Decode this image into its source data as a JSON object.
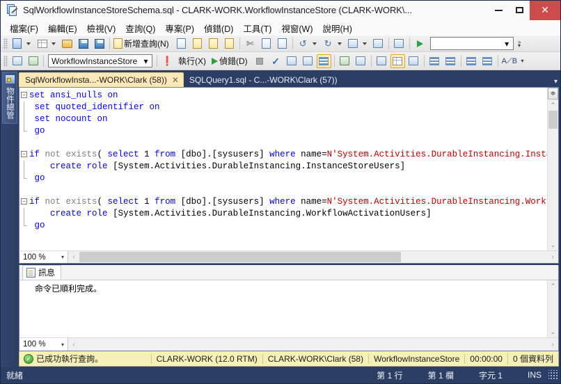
{
  "window": {
    "title": "SqlWorkflowInstanceStoreSchema.sql - CLARK-WORK.WorkflowInstanceStore (CLARK-WORK\\...",
    "minimize_label": "",
    "maximize_label": "",
    "close_label": "✕"
  },
  "menu": {
    "items": [
      {
        "label": "檔案(F)"
      },
      {
        "label": "編輯(E)"
      },
      {
        "label": "檢視(V)"
      },
      {
        "label": "查詢(Q)"
      },
      {
        "label": "專案(P)"
      },
      {
        "label": "偵錯(D)"
      },
      {
        "label": "工具(T)"
      },
      {
        "label": "視窗(W)"
      },
      {
        "label": "說明(H)"
      }
    ]
  },
  "toolbar_standard": {
    "new_query_label": "新增查詢(N)",
    "buttons": [
      {
        "name": "new-project-icon"
      },
      {
        "name": "new-item-icon"
      },
      {
        "name": "open-file-icon"
      },
      {
        "name": "save-icon"
      },
      {
        "name": "save-all-icon"
      },
      {
        "name": "new-query-icon"
      },
      {
        "name": "new-db-engine-query-icon"
      },
      {
        "name": "new-mdx-query-icon"
      },
      {
        "name": "new-dmx-query-icon"
      },
      {
        "name": "new-xmla-query-icon"
      },
      {
        "name": "cut-icon"
      },
      {
        "name": "copy-icon"
      },
      {
        "name": "paste-icon"
      },
      {
        "name": "undo-icon"
      },
      {
        "name": "redo-icon"
      },
      {
        "name": "navigate-icon"
      },
      {
        "name": "solution-icon"
      },
      {
        "name": "activity-monitor-icon"
      },
      {
        "name": "start-debug-icon"
      }
    ],
    "config_combo_value": ""
  },
  "toolbar_editor": {
    "database_value": "WorkflowInstanceStore",
    "execute_label": "執行(X)",
    "debug_label": "偵錯(D)",
    "buttons": [
      {
        "name": "connect-icon"
      },
      {
        "name": "disconnect-icon"
      },
      {
        "name": "execute-warning-icon"
      },
      {
        "name": "stop-icon"
      },
      {
        "name": "parse-icon"
      },
      {
        "name": "display-estimated-plan-icon"
      },
      {
        "name": "query-options-icon"
      },
      {
        "name": "include-actual-plan-icon",
        "active": true
      },
      {
        "name": "include-client-statistics-icon"
      },
      {
        "name": "sqlcmd-mode-icon"
      },
      {
        "name": "results-to-text-icon"
      },
      {
        "name": "results-to-grid-icon",
        "active": true
      },
      {
        "name": "results-to-file-icon"
      },
      {
        "name": "comment-icon"
      },
      {
        "name": "uncomment-icon"
      },
      {
        "name": "decrease-indent-icon"
      },
      {
        "name": "increase-indent-icon"
      },
      {
        "name": "specify-values-icon"
      }
    ]
  },
  "object_explorer": {
    "label": "物件總管"
  },
  "tabs": [
    {
      "label": "SqlWorkflowInsta...-WORK\\Clark (58))",
      "active": true,
      "close": "✕"
    },
    {
      "label": "SQLQuery1.sql - C...-WORK\\Clark (57))",
      "active": false
    }
  ],
  "editor": {
    "zoom": "100 %",
    "zoom_caret": "▾",
    "code_lines": [
      {
        "fold": "minus",
        "segments": [
          {
            "text": "set",
            "cls": "kw"
          },
          {
            "text": " ansi_nulls ",
            "cls": "kw"
          },
          {
            "text": "on",
            "cls": "kw"
          }
        ]
      },
      {
        "fold": "bar",
        "segments": [
          {
            "text": " set",
            "cls": "kw"
          },
          {
            "text": " quoted_identifier ",
            "cls": "kw"
          },
          {
            "text": "on",
            "cls": "kw"
          }
        ]
      },
      {
        "fold": "bar",
        "segments": [
          {
            "text": " set",
            "cls": "kw"
          },
          {
            "text": " nocount ",
            "cls": "kw"
          },
          {
            "text": "on",
            "cls": "kw"
          }
        ]
      },
      {
        "fold": "end",
        "segments": [
          {
            "text": " go",
            "cls": "kw"
          }
        ]
      },
      {
        "fold": "none",
        "segments": [
          {
            "text": "",
            "cls": "blk"
          }
        ]
      },
      {
        "fold": "minus",
        "segments": [
          {
            "text": "if",
            "cls": "kw"
          },
          {
            "text": " not exists",
            "cls": "gray"
          },
          {
            "text": "( ",
            "cls": "blk"
          },
          {
            "text": "select",
            "cls": "kw"
          },
          {
            "text": " 1 ",
            "cls": "blk"
          },
          {
            "text": "from",
            "cls": "kw"
          },
          {
            "text": " [dbo].[sysusers] ",
            "cls": "blk"
          },
          {
            "text": "where",
            "cls": "kw"
          },
          {
            "text": " name=",
            "cls": "blk"
          },
          {
            "text": "N'System.Activities.DurableInstancing.Instan",
            "cls": "str"
          }
        ]
      },
      {
        "fold": "bar",
        "segments": [
          {
            "text": "    ",
            "cls": "blk"
          },
          {
            "text": "create",
            "cls": "kw"
          },
          {
            "text": " ",
            "cls": "blk"
          },
          {
            "text": "role",
            "cls": "kw"
          },
          {
            "text": " [System.Activities.DurableInstancing.InstanceStoreUsers]",
            "cls": "blk"
          }
        ]
      },
      {
        "fold": "end",
        "segments": [
          {
            "text": " go",
            "cls": "kw"
          }
        ]
      },
      {
        "fold": "none",
        "segments": [
          {
            "text": "",
            "cls": "blk"
          }
        ]
      },
      {
        "fold": "minus",
        "segments": [
          {
            "text": "if",
            "cls": "kw"
          },
          {
            "text": " not exists",
            "cls": "gray"
          },
          {
            "text": "( ",
            "cls": "blk"
          },
          {
            "text": "select",
            "cls": "kw"
          },
          {
            "text": " 1 ",
            "cls": "blk"
          },
          {
            "text": "from",
            "cls": "kw"
          },
          {
            "text": " [dbo].[sysusers] ",
            "cls": "blk"
          },
          {
            "text": "where",
            "cls": "kw"
          },
          {
            "text": " name=",
            "cls": "blk"
          },
          {
            "text": "N'System.Activities.DurableInstancing.Workf",
            "cls": "str"
          }
        ]
      },
      {
        "fold": "bar",
        "segments": [
          {
            "text": "    ",
            "cls": "blk"
          },
          {
            "text": "create",
            "cls": "kw"
          },
          {
            "text": " ",
            "cls": "blk"
          },
          {
            "text": "role",
            "cls": "kw"
          },
          {
            "text": " [System.Activities.DurableInstancing.WorkflowActivationUsers]",
            "cls": "blk"
          }
        ]
      },
      {
        "fold": "end",
        "segments": [
          {
            "text": " go",
            "cls": "kw"
          }
        ]
      }
    ]
  },
  "results": {
    "tab_label": "訊息",
    "message": "命令已順利完成。",
    "zoom": "100 %",
    "zoom_caret": "▾"
  },
  "query_status": {
    "status_text": "已成功執行查詢。",
    "server": "CLARK-WORK (12.0 RTM)",
    "user": "CLARK-WORK\\Clark (58)",
    "database": "WorkflowInstanceStore",
    "elapsed": "00:00:00",
    "rows": "0 個資料列"
  },
  "statusbar": {
    "ready": "就緒",
    "line": "第 1 行",
    "column": "第 1 欄",
    "character": "字元 1",
    "insert_mode": "INS"
  },
  "colors": {
    "chrome": "#2c3e63",
    "accent_tab": "#fde9b8",
    "status_bar": "#f4f0b8",
    "close_button": "#cc4b4b",
    "keyword": "#0000ff",
    "string": "#c00000"
  }
}
